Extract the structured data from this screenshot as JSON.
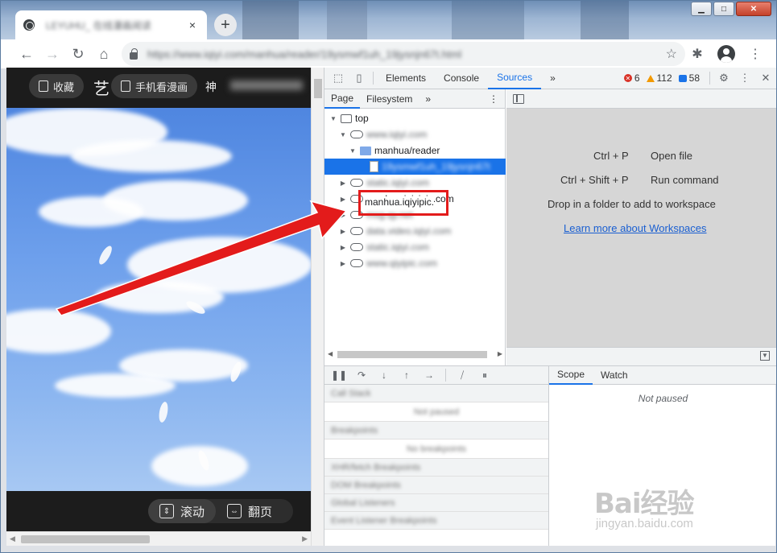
{
  "browser": {
    "tab_title": "LEYUHU_ 在线漫画阅读",
    "tab_close": "×",
    "new_tab": "+",
    "url": "https://www.iqiyi.com/manhua/reader/19ysmwf1uh_19jysnjn67t.html",
    "window_controls": {
      "minimize": "▁",
      "maximize": "□",
      "close": "✕"
    }
  },
  "toolbar": {
    "back": "←",
    "forward": "→",
    "reload": "↻",
    "home": "⌂",
    "bookmark_star": "☆",
    "extensions": "✱",
    "menu": "⋮"
  },
  "page": {
    "favorite_label": "收藏",
    "mobile_label": "手机看漫画",
    "title_fragment": "艺",
    "title_fragment2": "神",
    "blur_text": "第1话 出现",
    "scroll_mode_label": "滚动",
    "flip_mode_label": "翻页"
  },
  "devtools": {
    "tabs": [
      "Elements",
      "Console",
      "Sources"
    ],
    "active_tab": "Sources",
    "more": "»",
    "errors": "6",
    "warnings": "112",
    "info": "58",
    "navigator_tabs": [
      "Page",
      "Filesystem"
    ],
    "navigator_more": "»",
    "tree": [
      {
        "label": "top",
        "kind": "frame",
        "expanded": true,
        "indent": 0
      },
      {
        "label": "www.iqiyi.com",
        "kind": "cloud",
        "expanded": true,
        "indent": 1,
        "blurred": true
      },
      {
        "label": "manhua/reader",
        "kind": "folder",
        "expanded": true,
        "indent": 2
      },
      {
        "label": "19ysmwf1uh_19jysnjn67t",
        "kind": "file",
        "indent": 3,
        "selected": true,
        "blurred": true
      },
      {
        "label": "static.iqiyi.com",
        "kind": "cloud",
        "expanded": false,
        "indent": 1,
        "blurred": true
      },
      {
        "label": "manhua.iqiyipic.com",
        "kind": "cloud",
        "expanded": false,
        "indent": 1
      },
      {
        "label": "msg.qy.net",
        "kind": "cloud",
        "expanded": false,
        "indent": 1,
        "blurred": true
      },
      {
        "label": "data.video.iqiyi.com",
        "kind": "cloud",
        "expanded": false,
        "indent": 1,
        "blurred": true
      },
      {
        "label": "static.iqiyi.com",
        "kind": "cloud",
        "expanded": false,
        "indent": 1,
        "blurred": true
      },
      {
        "label": "www.qiyipic.com",
        "kind": "cloud",
        "expanded": false,
        "indent": 1,
        "blurred": true
      }
    ],
    "editor": {
      "shortcut1_keys": "Ctrl + P",
      "shortcut1_action": "Open file",
      "shortcut2_keys": "Ctrl + Shift + P",
      "shortcut2_action": "Run command",
      "drop_hint": "Drop in a folder to add to workspace",
      "learn_more": "Learn more about Workspaces"
    },
    "debugger_sections": [
      "Call Stack",
      "Not paused",
      "Breakpoints",
      "No breakpoints",
      "XHR/fetch Breakpoints",
      "DOM Breakpoints",
      "Global Listeners",
      "Event Listener Breakpoints"
    ],
    "scope_tabs": [
      "Scope",
      "Watch"
    ],
    "not_paused": "Not paused"
  },
  "annotation": {
    "highlight_text": "manhua.iqiyipic.",
    "color": "#e31b1b"
  },
  "watermark": {
    "logo": "Bai经验",
    "sub": "jingyan.baidu.com"
  }
}
